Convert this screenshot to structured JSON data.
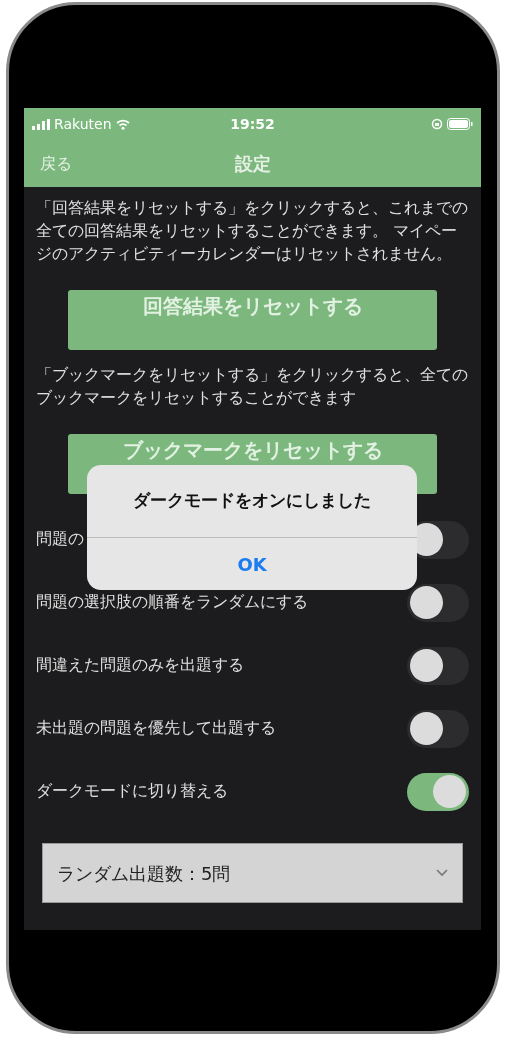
{
  "status_bar": {
    "carrier": "Rakuten",
    "time": "19:52"
  },
  "nav": {
    "back": "戻る",
    "title": "設定"
  },
  "sections": [
    {
      "description": "「回答結果をリセットする」をクリックすると、これまでの全ての回答結果をリセットすることができます。 マイページのアクティビティーカレンダーはリセットされません。",
      "button": "回答結果をリセットする"
    },
    {
      "description": "「ブックマークをリセットする」をクリックすると、全てのブックマークをリセットすることができます",
      "button": "ブックマークをリセットする"
    }
  ],
  "toggles": [
    {
      "label": "問題の",
      "on": false
    },
    {
      "label": "問題の選択肢の順番をランダムにする",
      "on": false
    },
    {
      "label": "間違えた問題のみを出題する",
      "on": false
    },
    {
      "label": "未出題の問題を優先して出題する",
      "on": false
    },
    {
      "label": "ダークモードに切り替える",
      "on": true
    }
  ],
  "dropdown": {
    "value": "ランダム出題数：5問"
  },
  "alert": {
    "message": "ダークモードをオンにしました",
    "button": "OK"
  }
}
